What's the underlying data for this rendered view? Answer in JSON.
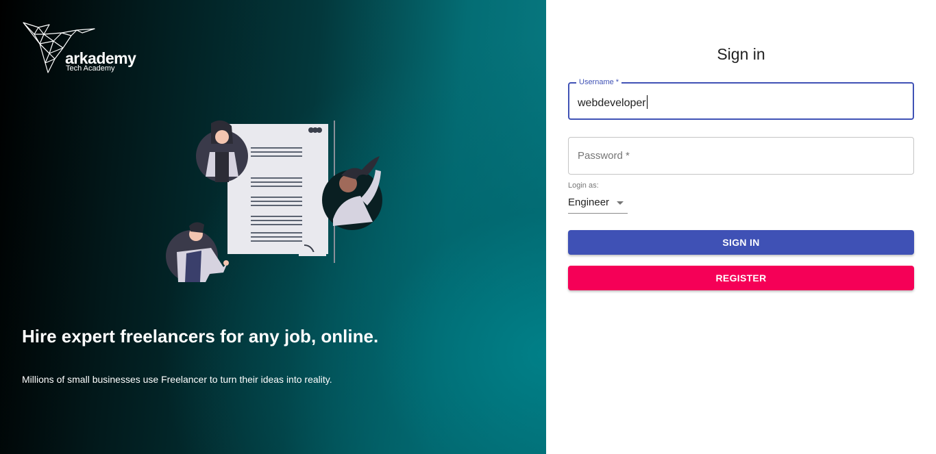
{
  "brand": {
    "name": "arkademy",
    "tagline": "Tech Academy"
  },
  "hero": {
    "headline": "Hire expert freelancers for any job, online.",
    "subline": "Millions of small businesses use Freelancer to turn their ideas into reality."
  },
  "form": {
    "title": "Sign in",
    "username_label": "Username *",
    "username_value": "webdeveloper",
    "password_placeholder": "Password *",
    "login_as_label": "Login as:",
    "login_as_value": "Engineer",
    "signin_label": "SIGN IN",
    "register_label": "REGISTER"
  },
  "colors": {
    "primary": "#3f51b5",
    "secondary": "#f50057",
    "hero_teal": "#077a82"
  }
}
